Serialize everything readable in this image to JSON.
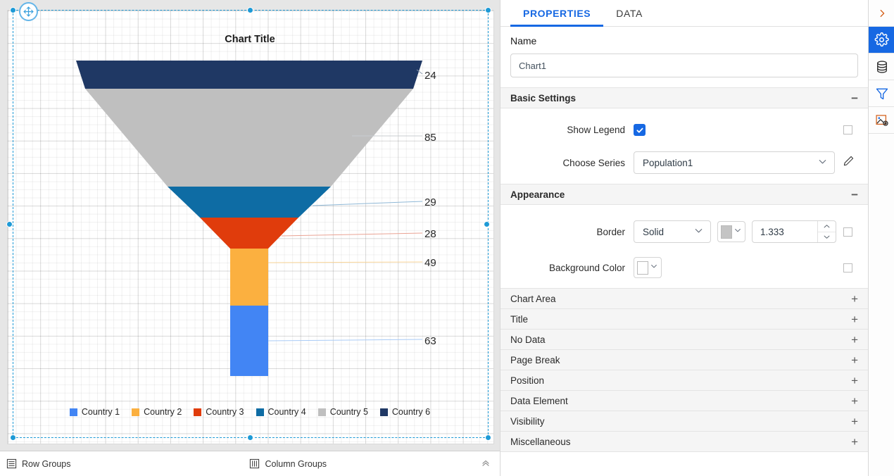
{
  "designer": {
    "chart_title": "Chart Title",
    "bottom_bar": {
      "row_groups_label": "Row Groups",
      "column_groups_label": "Column Groups",
      "collapse_icon": "chevron-up-icon"
    },
    "move_handle_icon": "move-icon"
  },
  "chart_data": {
    "type": "funnel",
    "title": "Chart Title",
    "xlabel": "",
    "ylabel": "",
    "categories": [
      "Country 6",
      "Country 5",
      "Country 4",
      "Country 3",
      "Country 2",
      "Country 1"
    ],
    "values": [
      24,
      85,
      29,
      28,
      49,
      63
    ],
    "data_labels": [
      "24",
      "85",
      "29",
      "28",
      "49",
      "63"
    ],
    "colors": [
      "#1F3864",
      "#BFBFBF",
      "#0E6CA4",
      "#E03C0C",
      "#FBB040",
      "#4285F4"
    ],
    "legend": {
      "position": "bottom",
      "entries": [
        {
          "label": "Country 1",
          "color": "#4285F4"
        },
        {
          "label": "Country 2",
          "color": "#FBB040"
        },
        {
          "label": "Country 3",
          "color": "#E03C0C"
        },
        {
          "label": "Country 4",
          "color": "#0E6CA4"
        },
        {
          "label": "Country 5",
          "color": "#BFBFBF"
        },
        {
          "label": "Country 6",
          "color": "#1F3864"
        }
      ]
    },
    "grid": true
  },
  "properties": {
    "tabs": [
      {
        "id": "properties",
        "label": "PROPERTIES",
        "active": true
      },
      {
        "id": "data",
        "label": "DATA",
        "active": false
      }
    ],
    "name_field": {
      "label": "Name",
      "value": "Chart1",
      "placeholder": "Name"
    },
    "basic_settings": {
      "title": "Basic Settings",
      "toggle_sign": "−",
      "show_legend": {
        "label": "Show Legend",
        "checked": true,
        "check_glyph": "✓"
      },
      "choose_series": {
        "label": "Choose Series",
        "value": "Population1",
        "dropdown_icon": "chevron-down-icon",
        "edit_icon": "pencil-icon"
      }
    },
    "appearance": {
      "title": "Appearance",
      "toggle_sign": "−",
      "border": {
        "label": "Border",
        "style_value": "Solid",
        "color_value": "#C4C4C4",
        "width_value": "1.333",
        "dropdown_icon": "chevron-down-icon",
        "spinner_up_icon": "chevron-up-icon",
        "spinner_down_icon": "chevron-down-icon"
      },
      "background_color": {
        "label": "Background Color",
        "color_value": "#FFFFFF",
        "dropdown_icon": "chevron-down-icon"
      }
    },
    "collapsed_sections": [
      {
        "label": "Chart Area",
        "sign": "+"
      },
      {
        "label": "Title",
        "sign": "+"
      },
      {
        "label": "No Data",
        "sign": "+"
      },
      {
        "label": "Page Break",
        "sign": "+"
      },
      {
        "label": "Position",
        "sign": "+"
      },
      {
        "label": "Data Element",
        "sign": "+"
      },
      {
        "label": "Visibility",
        "sign": "+"
      },
      {
        "label": "Miscellaneous",
        "sign": "+"
      }
    ]
  },
  "rail": {
    "items": [
      {
        "icon": "chevron-right-icon",
        "active": false
      },
      {
        "icon": "gear-icon",
        "active": true
      },
      {
        "icon": "database-icon",
        "active": false
      },
      {
        "icon": "filter-icon",
        "active": false
      },
      {
        "icon": "image-settings-icon",
        "active": false
      }
    ]
  },
  "theme": {
    "accent": "#1668e3",
    "selection": "#1e9ad6",
    "panel_bg": "#f5f5f5",
    "canvas_bg": "#e6e6e6"
  }
}
